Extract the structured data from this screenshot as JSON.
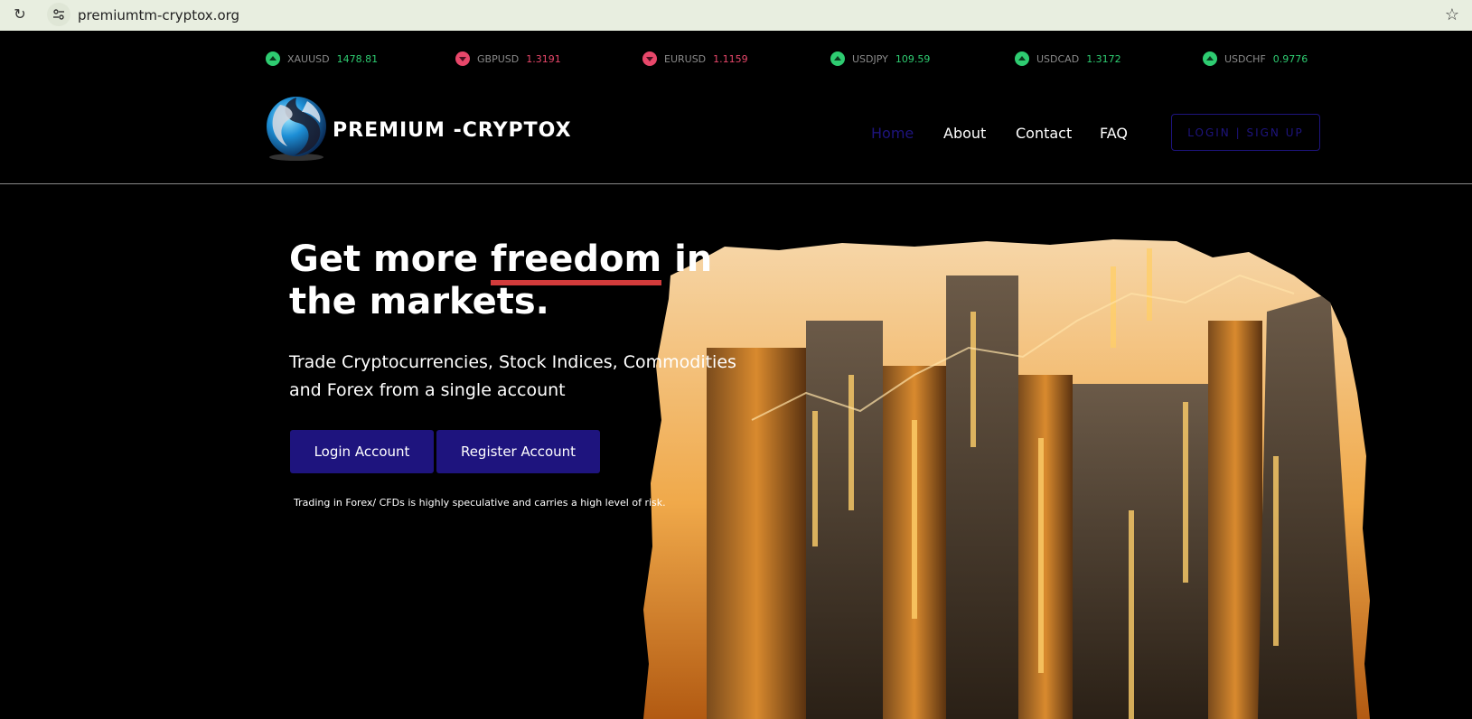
{
  "browser": {
    "url": "premiumtm-cryptox.org"
  },
  "ticker": [
    {
      "symbol": "XAUUSD",
      "value": "1478.81",
      "trend": "up"
    },
    {
      "symbol": "GBPUSD",
      "value": "1.3191",
      "trend": "down"
    },
    {
      "symbol": "EURUSD",
      "value": "1.1159",
      "trend": "down"
    },
    {
      "symbol": "USDJPY",
      "value": "109.59",
      "trend": "up"
    },
    {
      "symbol": "USDCAD",
      "value": "1.3172",
      "trend": "up"
    },
    {
      "symbol": "USDCHF",
      "value": "0.9776",
      "trend": "up"
    }
  ],
  "brand": {
    "name": "PREMIUM -CRYPTOX"
  },
  "nav": {
    "home": "Home",
    "about": "About",
    "contact": "Contact",
    "faq": "FAQ",
    "auth": "LOGIN | SIGN UP"
  },
  "hero": {
    "headline_pre": "Get more ",
    "headline_highlight": "freedom",
    "headline_post": " in the markets.",
    "subtitle": "Trade Cryptocurrencies, Stock Indices, Commodities and Forex from a single account",
    "login_button": "Login Account",
    "register_button": "Register Account",
    "risk_notice": "Trading in Forex/ CFDs is highly speculative and carries a high level of risk."
  },
  "colors": {
    "accent": "#1e147e",
    "up": "#2ecc71",
    "down": "#e8476a",
    "highlight_underline": "#d23b3b"
  },
  "icons": [
    "reload-icon",
    "site-info-icon",
    "bookmark-star-icon",
    "trend-up-icon",
    "trend-down-icon"
  ]
}
